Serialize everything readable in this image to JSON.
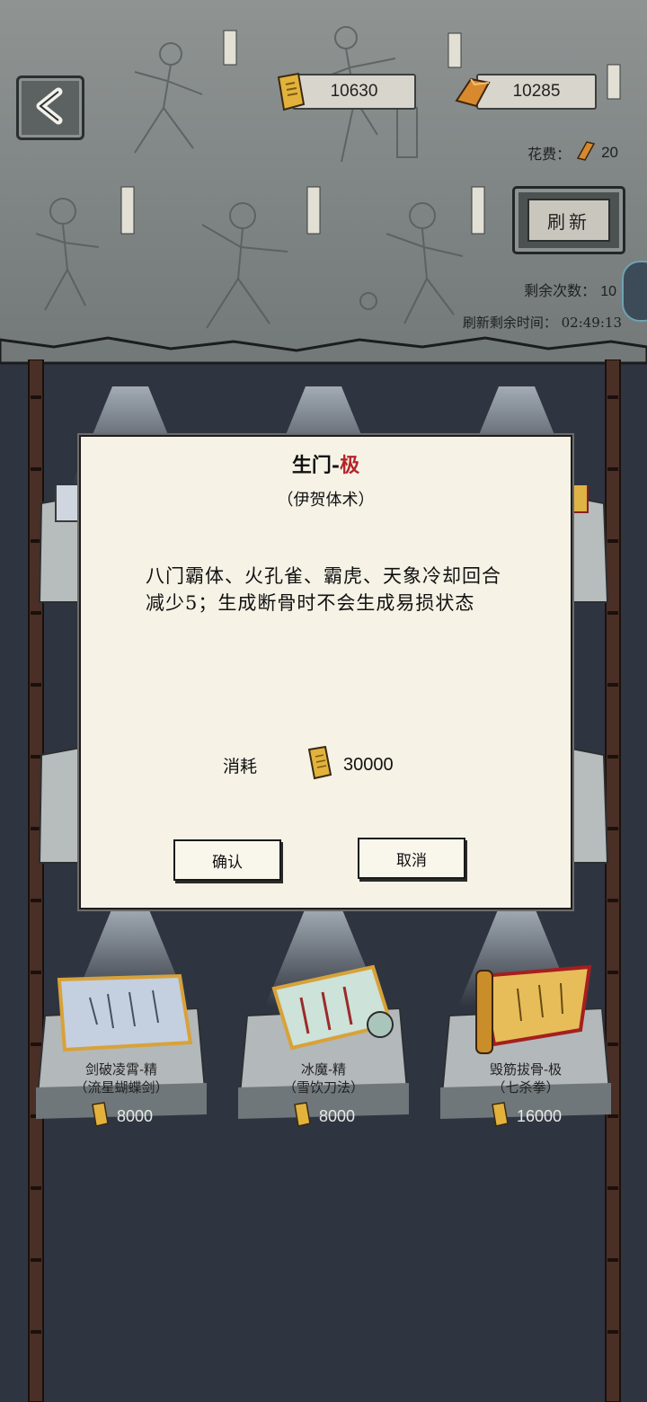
{
  "header": {
    "currency_scroll": "10630",
    "currency_gold": "10285",
    "cost_label": "花费：",
    "cost_value": "20",
    "refresh_label": "刷新",
    "remaining_label": "剩余次数：",
    "remaining_value": "10",
    "timer_label": "刷新剩余时间：",
    "timer_value": "02:49:13"
  },
  "modal": {
    "title": "生门-",
    "grade": "极",
    "subtitle": "（伊贺体术）",
    "description": "八门霸体、火孔雀、霸虎、天象冷却回合减少5；生成断骨时不会生成易损状态",
    "cost_label": "消耗",
    "cost_value": "30000",
    "confirm_label": "确认",
    "cancel_label": "取消"
  },
  "shop_items": [
    {
      "name": "剑破凌霄-精",
      "school": "（流星蝴蝶剑）",
      "price": "8000"
    },
    {
      "name": "冰魔-精",
      "school": "（雪饮刀法）",
      "price": "8000"
    },
    {
      "name": "毁筋拔骨-极",
      "school": "（七杀拳）",
      "price": "16000"
    }
  ],
  "colors": {
    "grade_red": "#b2262a",
    "modal_bg": "#f6f2e6",
    "scroll_gold": "#e2b23c"
  },
  "icons": {
    "back": "chevron-left-icon",
    "scroll_currency": "scroll-icon",
    "gold_currency": "gold-bar-icon"
  }
}
